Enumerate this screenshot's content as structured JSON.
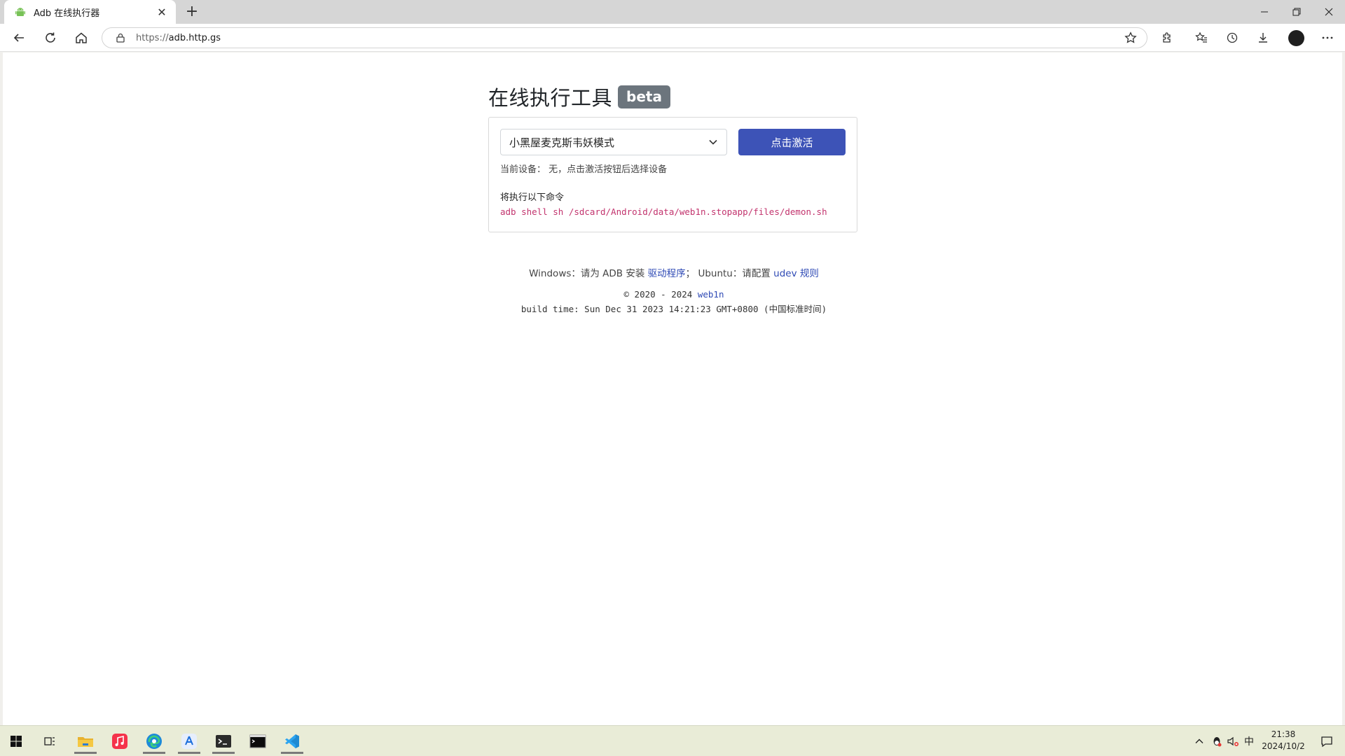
{
  "browser": {
    "tab": {
      "title": "Adb 在线执行器",
      "favicon": "android-icon"
    },
    "address": {
      "protocol": "https://",
      "host": "adb.http.gs"
    },
    "window_controls": [
      "minimize",
      "restore",
      "close"
    ]
  },
  "page": {
    "title": "在线执行工具",
    "badge": "beta",
    "select": {
      "value": "小黑屋麦克斯韦妖模式"
    },
    "activate_button": "点击激活",
    "device_status": "当前设备：  无，点击激活按钮后选择设备",
    "command_label": "将执行以下命令",
    "command": "adb shell sh /sdcard/Android/data/web1n.stopapp/files/demon.sh",
    "footer": {
      "windows_prefix": "Windows：请为 ADB 安装 ",
      "windows_link": "驱动程序",
      "ubuntu_prefix": "； Ubuntu：请配置 ",
      "ubuntu_link": "udev 规则",
      "copyright_prefix": "© 2020 - 2024 ",
      "copyright_link": "web1n",
      "build_time": "build time: Sun Dec 31 2023 14:21:23 GMT+0800 (中国标准时间)"
    }
  },
  "taskbar": {
    "apps": [
      "start-icon",
      "task-view-icon",
      "file-explorer-icon",
      "music-icon",
      "edge-icon",
      "app-store-icon",
      "terminal-icon",
      "console-icon",
      "vscode-icon"
    ],
    "tray": {
      "ime": "中"
    },
    "clock": {
      "time": "21:38",
      "date": "2024/10/2"
    }
  },
  "colors": {
    "accent_button": "#3d53b7",
    "link": "#2f4ab5",
    "command_text": "#c2336d",
    "badge_bg": "#6c757d"
  }
}
